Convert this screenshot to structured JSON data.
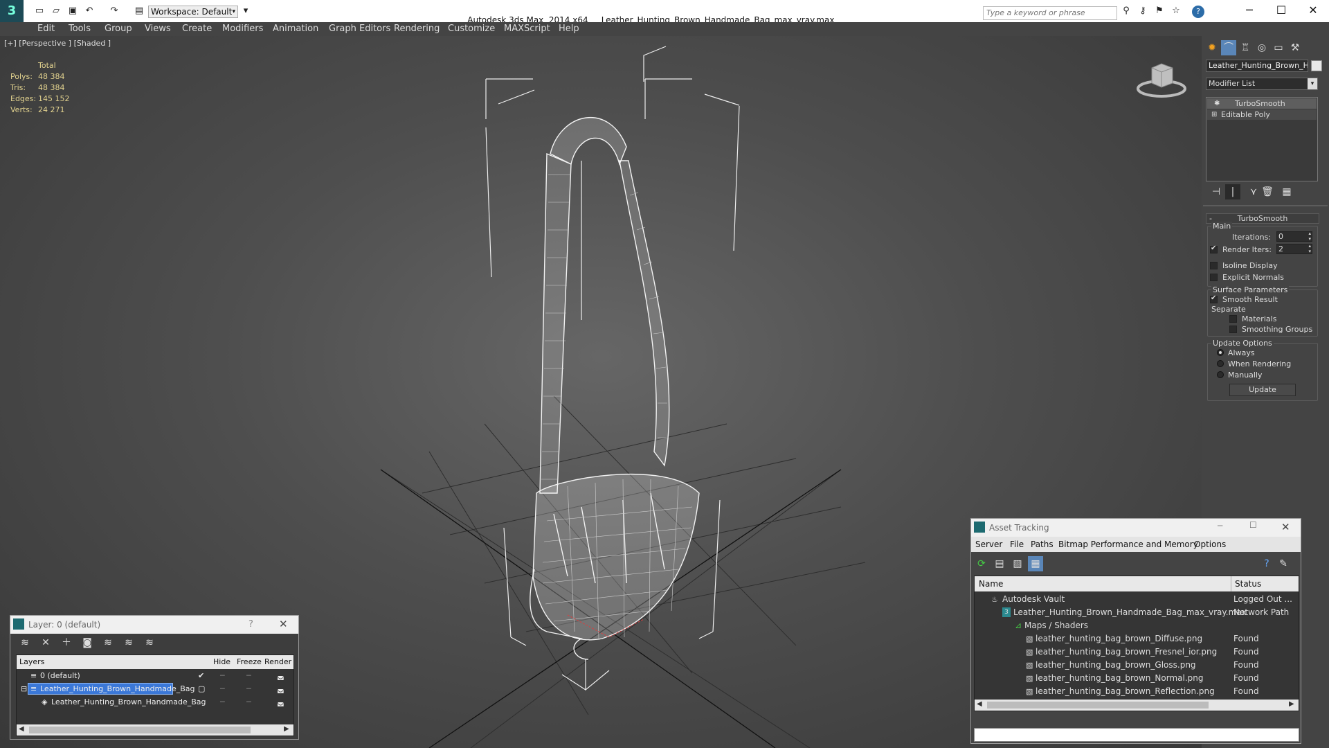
{
  "app": {
    "title": "Autodesk 3ds Max  2014 x64",
    "filename": "Leather_Hunting_Brown_Handmade_Bag_max_vray.max",
    "workspace": "Workspace: Default",
    "search_placeholder": "Type a keyword or phrase"
  },
  "menu": [
    "Edit",
    "Tools",
    "Group",
    "Views",
    "Create",
    "Modifiers",
    "Animation",
    "Graph Editors",
    "Rendering",
    "Customize",
    "MAXScript",
    "Help"
  ],
  "viewport": {
    "label": "[+] [Perspective ] [Shaded ]",
    "stats": {
      "header": "Total",
      "rows": [
        {
          "k": "Polys:",
          "v": "48 384"
        },
        {
          "k": "Tris:",
          "v": "48 384"
        },
        {
          "k": "Edges:",
          "v": "145 152"
        },
        {
          "k": "Verts:",
          "v": "24 271"
        }
      ]
    }
  },
  "command_panel": {
    "object_name": "Leather_Hunting_Brown_Han",
    "modifier_list": "Modifier List",
    "stack": [
      "TurboSmooth",
      "Editable Poly"
    ],
    "rollout_title": "TurboSmooth",
    "main_group": "Main",
    "iterations_label": "Iterations:",
    "iterations_value": "0",
    "render_iters_label": "Render Iters:",
    "render_iters_value": "2",
    "isoline": "Isoline Display",
    "explicit_normals": "Explicit Normals",
    "surface_group": "Surface Parameters",
    "smooth_result": "Smooth Result",
    "separate": "Separate",
    "materials": "Materials",
    "smoothing_groups": "Smoothing Groups",
    "update_group": "Update Options",
    "always": "Always",
    "when_rendering": "When Rendering",
    "manually": "Manually",
    "update_button": "Update"
  },
  "layer_window": {
    "title": "Layer: 0 (default)",
    "help": "?",
    "columns": {
      "layers": "Layers",
      "hide": "Hide",
      "freeze": "Freeze",
      "render": "Render"
    },
    "rows": [
      "0 (default)",
      "Leather_Hunting_Brown_Handmade_Bag",
      "Leather_Hunting_Brown_Handmade_Bag"
    ]
  },
  "asset_tracking": {
    "title": "Asset Tracking",
    "menu": [
      "Server",
      "File",
      "Paths",
      "Bitmap Performance and Memory",
      "Options"
    ],
    "columns": {
      "name": "Name",
      "status": "Status"
    },
    "rows": [
      {
        "name": "Autodesk Vault",
        "status": "Logged Out ..."
      },
      {
        "name": "Leather_Hunting_Brown_Handmade_Bag_max_vray.max",
        "status": "Network Path"
      },
      {
        "name": "Maps / Shaders",
        "status": ""
      },
      {
        "name": "leather_hunting_bag_brown_Diffuse.png",
        "status": "Found"
      },
      {
        "name": "leather_hunting_bag_brown_Fresnel_ior.png",
        "status": "Found"
      },
      {
        "name": "leather_hunting_bag_brown_Gloss.png",
        "status": "Found"
      },
      {
        "name": "leather_hunting_bag_brown_Normal.png",
        "status": "Found"
      },
      {
        "name": "leather_hunting_bag_brown_Reflection.png",
        "status": "Found"
      }
    ]
  }
}
